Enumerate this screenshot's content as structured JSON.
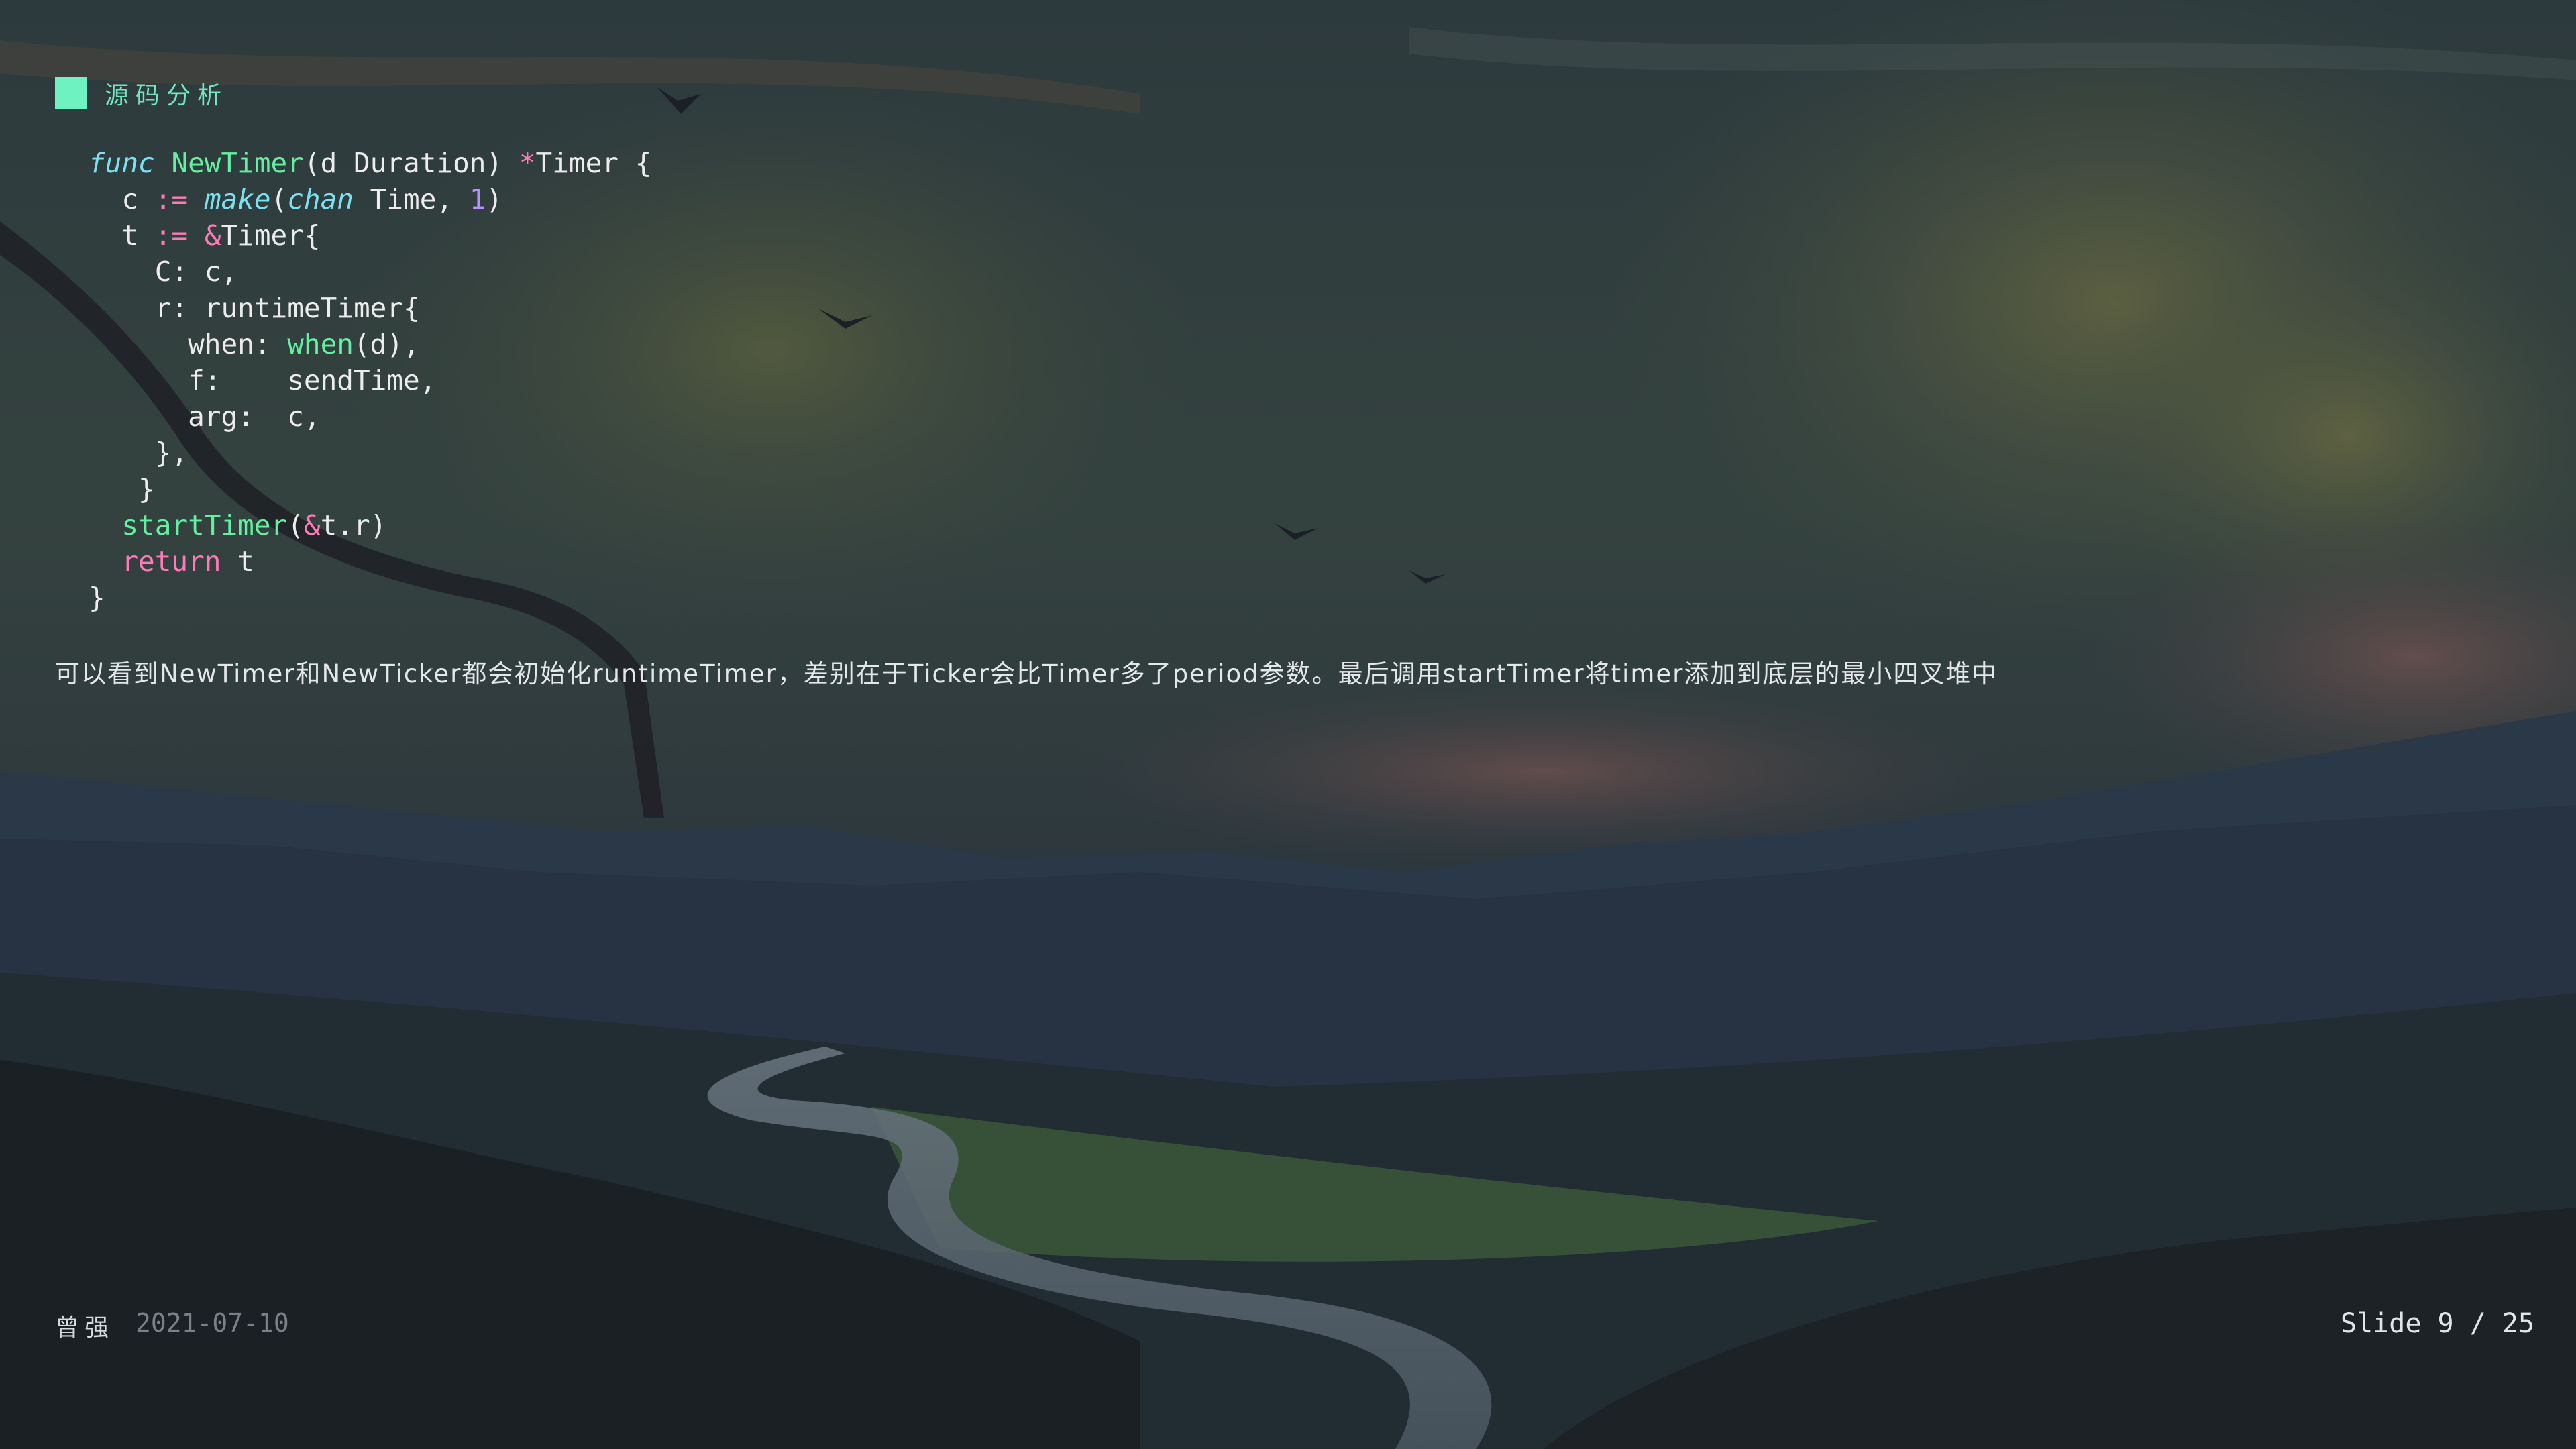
{
  "heading": {
    "text": "源码分析",
    "marker_color": "#6ef2c2",
    "icon": "square-marker-icon"
  },
  "code": {
    "language": "go",
    "lines": [
      [
        {
          "t": "kw",
          "v": "func"
        },
        {
          "t": "plain",
          "v": " "
        },
        {
          "t": "fn",
          "v": "NewTimer"
        },
        {
          "t": "plain",
          "v": "(d Duration) "
        },
        {
          "t": "op",
          "v": "*"
        },
        {
          "t": "plain",
          "v": "Timer {"
        }
      ],
      [
        {
          "t": "plain",
          "v": "  c "
        },
        {
          "t": "op",
          "v": ":="
        },
        {
          "t": "plain",
          "v": " "
        },
        {
          "t": "kw",
          "v": "make"
        },
        {
          "t": "plain",
          "v": "("
        },
        {
          "t": "kw",
          "v": "chan"
        },
        {
          "t": "plain",
          "v": " Time, "
        },
        {
          "t": "num",
          "v": "1"
        },
        {
          "t": "plain",
          "v": ")"
        }
      ],
      [
        {
          "t": "plain",
          "v": "  t "
        },
        {
          "t": "op",
          "v": ":="
        },
        {
          "t": "plain",
          "v": " "
        },
        {
          "t": "op",
          "v": "&"
        },
        {
          "t": "plain",
          "v": "Timer{"
        }
      ],
      [
        {
          "t": "plain",
          "v": "    C: c,"
        }
      ],
      [
        {
          "t": "plain",
          "v": "    r: runtimeTimer{"
        }
      ],
      [
        {
          "t": "plain",
          "v": "      when: "
        },
        {
          "t": "fn",
          "v": "when"
        },
        {
          "t": "plain",
          "v": "(d),"
        }
      ],
      [
        {
          "t": "plain",
          "v": "      f:    sendTime,"
        }
      ],
      [
        {
          "t": "plain",
          "v": "      arg:  c,"
        }
      ],
      [
        {
          "t": "plain",
          "v": "    },"
        }
      ],
      [
        {
          "t": "plain",
          "v": "   }"
        }
      ],
      [
        {
          "t": "plain",
          "v": "  "
        },
        {
          "t": "fn",
          "v": "startTimer"
        },
        {
          "t": "plain",
          "v": "("
        },
        {
          "t": "op",
          "v": "&"
        },
        {
          "t": "plain",
          "v": "t.r)"
        }
      ],
      [
        {
          "t": "plain",
          "v": "  "
        },
        {
          "t": "ret",
          "v": "return"
        },
        {
          "t": "plain",
          "v": " t"
        }
      ],
      [
        {
          "t": "plain",
          "v": "}"
        }
      ]
    ]
  },
  "note": {
    "text": "可以看到NewTimer和NewTicker都会初始化runtimeTimer，差别在于Ticker会比Timer多了period参数。最后调用startTimer将timer添加到底层的最小四叉堆中"
  },
  "footer": {
    "author": "曾强",
    "date": "2021-07-10",
    "slide_label": "Slide 9 / 25"
  },
  "colors": {
    "heading_text": "#74e6bd",
    "keyword": "#7ce0f0",
    "function": "#63f0a0",
    "operator": "#ff7ab8",
    "number": "#b891ff",
    "date": "#7b8088"
  }
}
